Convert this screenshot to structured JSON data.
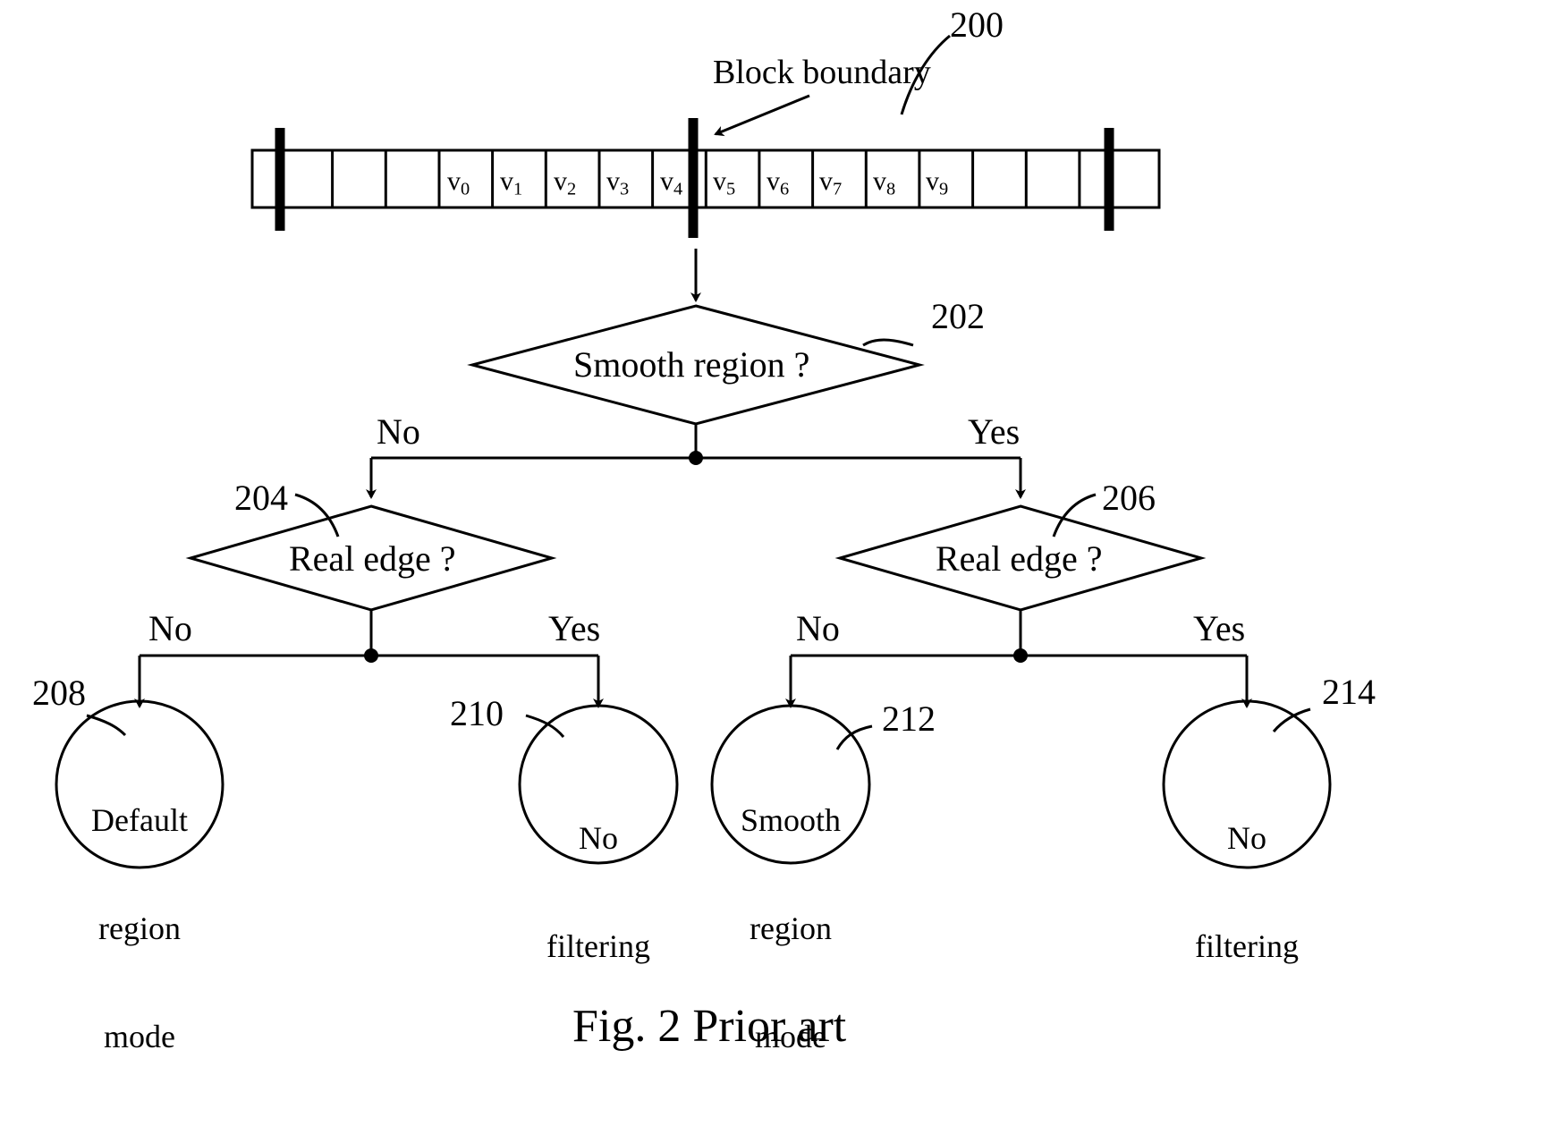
{
  "figure": {
    "caption": "Fig. 2 Prior art",
    "top_ref": "200",
    "boundary_label": "Block boundary"
  },
  "pixel_row": {
    "cells": [
      {
        "label": "",
        "sub": ""
      },
      {
        "label": "",
        "sub": ""
      },
      {
        "label": "",
        "sub": ""
      },
      {
        "label": "",
        "sub": ""
      },
      {
        "label": "v",
        "sub": "0"
      },
      {
        "label": "v",
        "sub": "1"
      },
      {
        "label": "v",
        "sub": "2"
      },
      {
        "label": "v",
        "sub": "3"
      },
      {
        "label": "v",
        "sub": "4"
      },
      {
        "label": "v",
        "sub": "5"
      },
      {
        "label": "v",
        "sub": "6"
      },
      {
        "label": "v",
        "sub": "7"
      },
      {
        "label": "v",
        "sub": "8"
      },
      {
        "label": "v",
        "sub": "9"
      },
      {
        "label": "",
        "sub": ""
      },
      {
        "label": "",
        "sub": ""
      },
      {
        "label": "",
        "sub": ""
      }
    ],
    "bold_divider_indices": [
      1,
      9,
      16
    ]
  },
  "decisions": {
    "smooth_region": {
      "ref": "202",
      "text": "Smooth region ?",
      "no_label": "No",
      "yes_label": "Yes"
    },
    "real_edge_left": {
      "ref": "204",
      "text": "Real edge ?",
      "no_label": "No",
      "yes_label": "Yes"
    },
    "real_edge_right": {
      "ref": "206",
      "text": "Real edge ?",
      "no_label": "No",
      "yes_label": "Yes"
    }
  },
  "outcomes": [
    {
      "ref": "208",
      "line1": "Default",
      "line2": "region",
      "line3": "mode"
    },
    {
      "ref": "210",
      "line1": "No",
      "line2": "filtering",
      "line3": ""
    },
    {
      "ref": "212",
      "line1": "Smooth",
      "line2": "region",
      "line3": "mode"
    },
    {
      "ref": "214",
      "line1": "No",
      "line2": "filtering",
      "line3": ""
    }
  ],
  "colors": {
    "ink": "#000000",
    "paper": "#ffffff"
  }
}
